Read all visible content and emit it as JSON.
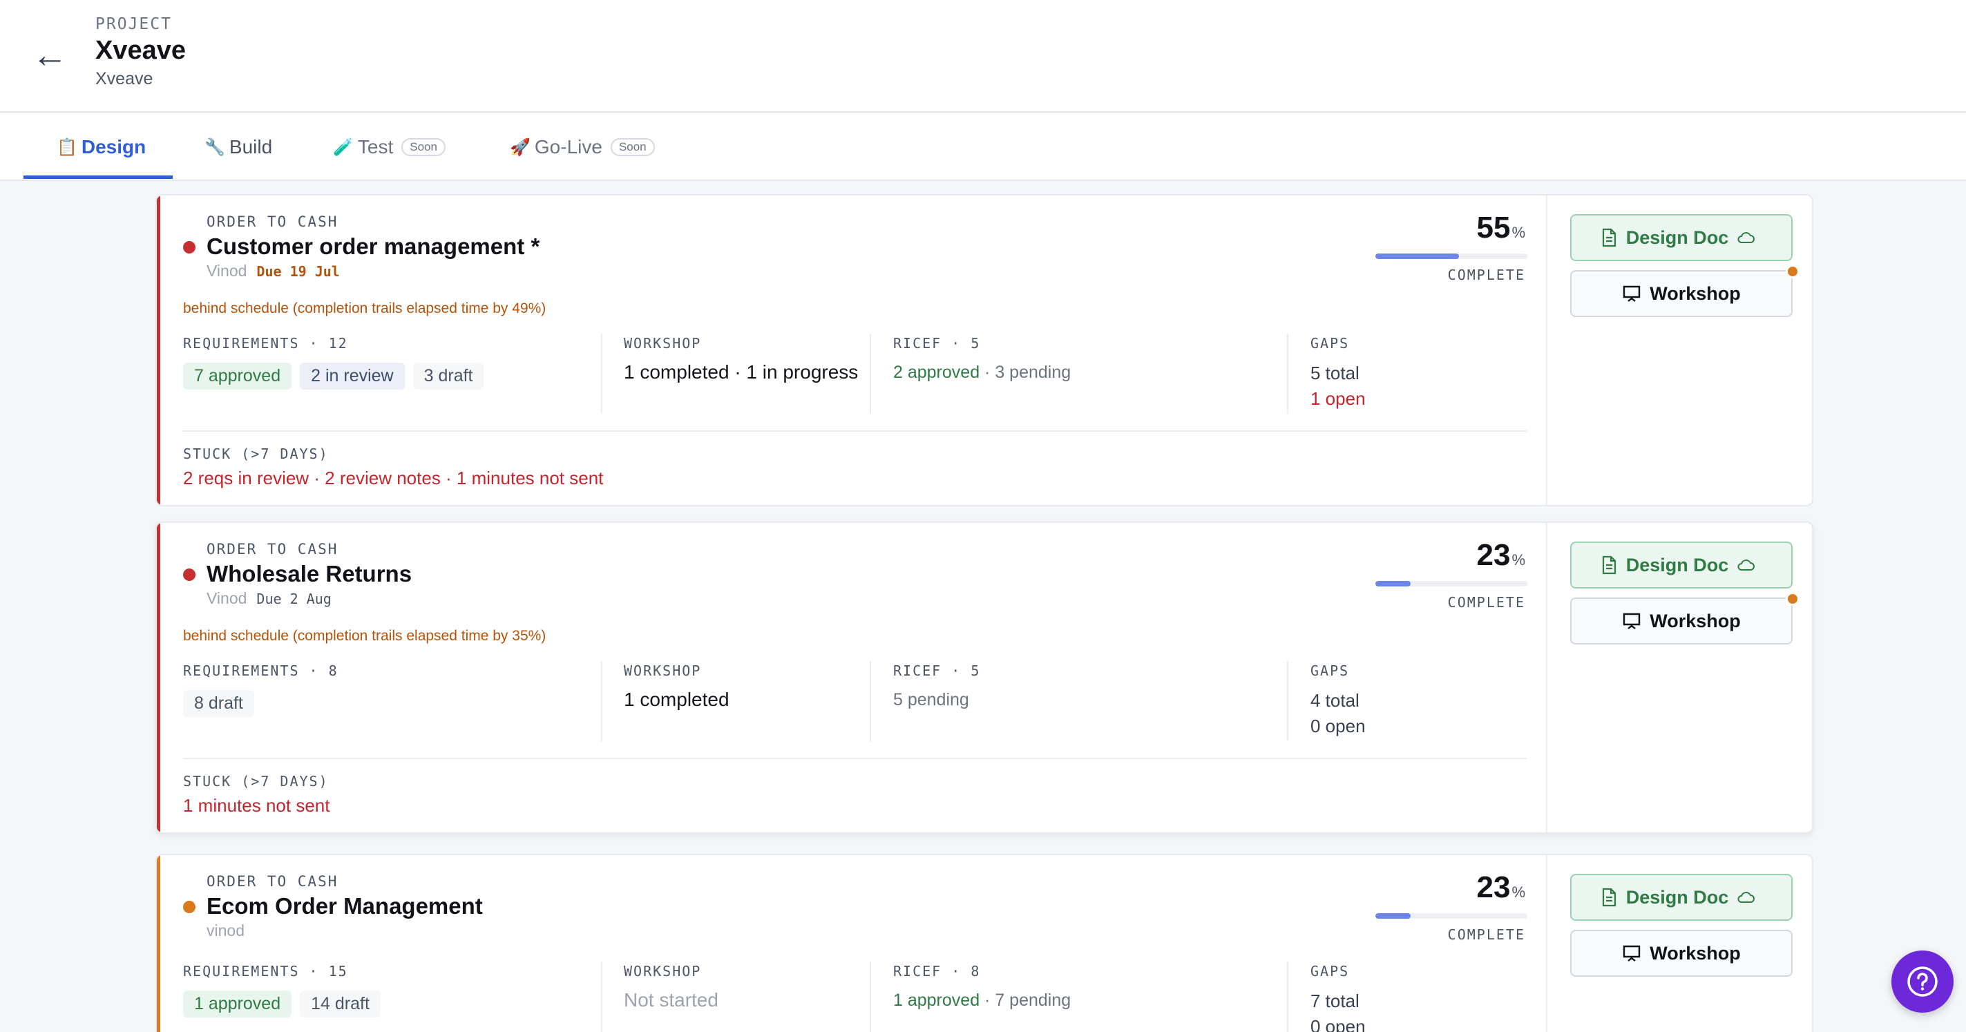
{
  "header": {
    "back_icon": "←",
    "project_label": "PROJECT",
    "project_title": "Xveave",
    "project_subtitle": "Xveave"
  },
  "tabs": [
    {
      "icon": "📋",
      "label": "Design",
      "active": true
    },
    {
      "icon": "🔧",
      "label": "Build"
    },
    {
      "icon": "🧪",
      "label": "Test",
      "badge": "Soon"
    },
    {
      "icon": "🚀",
      "label": "Go-Live",
      "badge": "Soon"
    }
  ],
  "cards": [
    {
      "category": "ORDER TO CASH",
      "title": "Customer order management *",
      "owner": "Vinod",
      "due": "Due 19 Jul",
      "status_color": "#c62f2f",
      "warning": "behind schedule (completion trails elapsed time by 49%)",
      "percent": "55",
      "percent_sign": "%",
      "progress": 0.55,
      "complete_label": "COMPLETE",
      "requirements_label": "REQUIREMENTS · 12",
      "requirements": [
        "7 approved",
        "2 in review",
        "3 draft"
      ],
      "workshop_label": "WORKSHOP",
      "workshop_value": "1 completed · 1 in progress",
      "ricef_label": "RICEF · 5",
      "ricef_approved": "2 approved",
      "ricef_pending": " · 3 pending",
      "gaps_label": "GAPS",
      "gaps_total": "5 total",
      "gaps_open": "1 open",
      "stuck_label": "STUCK (>7 DAYS)",
      "stuck_value": "2 reqs in review · 2 review notes · 1 minutes not sent",
      "doc_button": "Design Doc",
      "workshop_button": "Workshop"
    },
    {
      "category": "ORDER TO CASH",
      "title": "Wholesale Returns",
      "owner": "Vinod",
      "due": "Due 2 Aug",
      "status_color": "#c62f2f",
      "warning": "behind schedule (completion trails elapsed time by 35%)",
      "percent": "23",
      "percent_sign": "%",
      "progress": 0.23,
      "complete_label": "COMPLETE",
      "requirements_label": "REQUIREMENTS · 8",
      "requirements": [
        "8 draft"
      ],
      "workshop_label": "WORKSHOP",
      "workshop_value": "1 completed",
      "ricef_label": "RICEF · 5",
      "ricef_value": "5 pending",
      "gaps_label": "GAPS",
      "gaps_total": "4 total",
      "gaps_open": "0 open",
      "stuck_label": "STUCK (>7 DAYS)",
      "stuck_value": "1 minutes not sent",
      "doc_button": "Design Doc",
      "workshop_button": "Workshop"
    },
    {
      "category": "ORDER TO CASH",
      "title": "Ecom Order Management",
      "owner": "vinod",
      "status_color": "#d97a1f",
      "percent": "23",
      "percent_sign": "%",
      "progress": 0.23,
      "complete_label": "COMPLETE",
      "requirements_label": "REQUIREMENTS · 15",
      "requirements": [
        "1 approved",
        "14 draft"
      ],
      "workshop_label": "WORKSHOP",
      "workshop_value": "Not started",
      "ricef_label": "RICEF · 8",
      "ricef_approved": "1 approved",
      "ricef_pending": " · 7 pending",
      "gaps_label": "GAPS",
      "gaps_total": "7 total",
      "gaps_open": "0 open",
      "doc_button": "Design Doc",
      "workshop_button": "Workshop"
    }
  ],
  "help_icon": "question-icon"
}
